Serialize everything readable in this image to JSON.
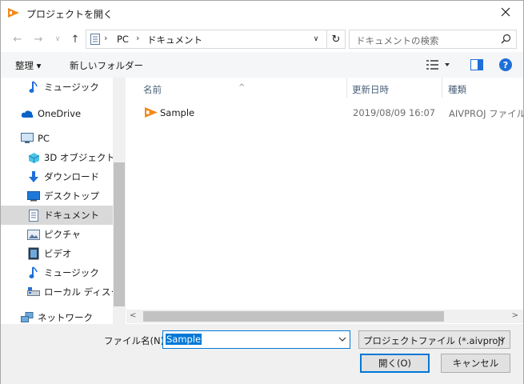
{
  "window": {
    "title": "プロジェクトを開く"
  },
  "address": {
    "crumbs": [
      "PC",
      "ドキュメント"
    ]
  },
  "search": {
    "placeholder": "ドキュメントの検索"
  },
  "toolbar": {
    "organize": "整理 ▾",
    "new_folder": "新しいフォルダー"
  },
  "nav": {
    "items": [
      {
        "label": "ミュージック",
        "icon": "music-icon"
      },
      {
        "label": "OneDrive",
        "icon": "cloud-icon"
      },
      {
        "label": "PC",
        "icon": "computer-icon"
      },
      {
        "label": "3D オブジェクト",
        "icon": "cube-icon"
      },
      {
        "label": "ダウンロード",
        "icon": "download-icon"
      },
      {
        "label": "デスクトップ",
        "icon": "desktop-icon"
      },
      {
        "label": "ドキュメント",
        "icon": "document-icon"
      },
      {
        "label": "ピクチャ",
        "icon": "picture-icon"
      },
      {
        "label": "ビデオ",
        "icon": "video-icon"
      },
      {
        "label": "ミュージック",
        "icon": "music-icon"
      },
      {
        "label": "ローカル ディスク (C",
        "icon": "disk-icon"
      },
      {
        "label": "ネットワーク",
        "icon": "network-icon"
      }
    ]
  },
  "files": {
    "columns": {
      "name": "名前",
      "date": "更新日時",
      "type": "種類"
    },
    "rows": [
      {
        "name": "Sample",
        "date": "2019/08/09 16:07",
        "type": "AIVPROJ ファイル"
      }
    ]
  },
  "bottom": {
    "filename_label": "ファイル名(N):",
    "filename_value": "Sample",
    "filetype_value": "プロジェクトファイル (*.aivproj)",
    "open_label": "開く(O)",
    "cancel_label": "キャンセル"
  },
  "colors": {
    "accent": "#0078d7",
    "app_icon": "#f08a1c"
  }
}
